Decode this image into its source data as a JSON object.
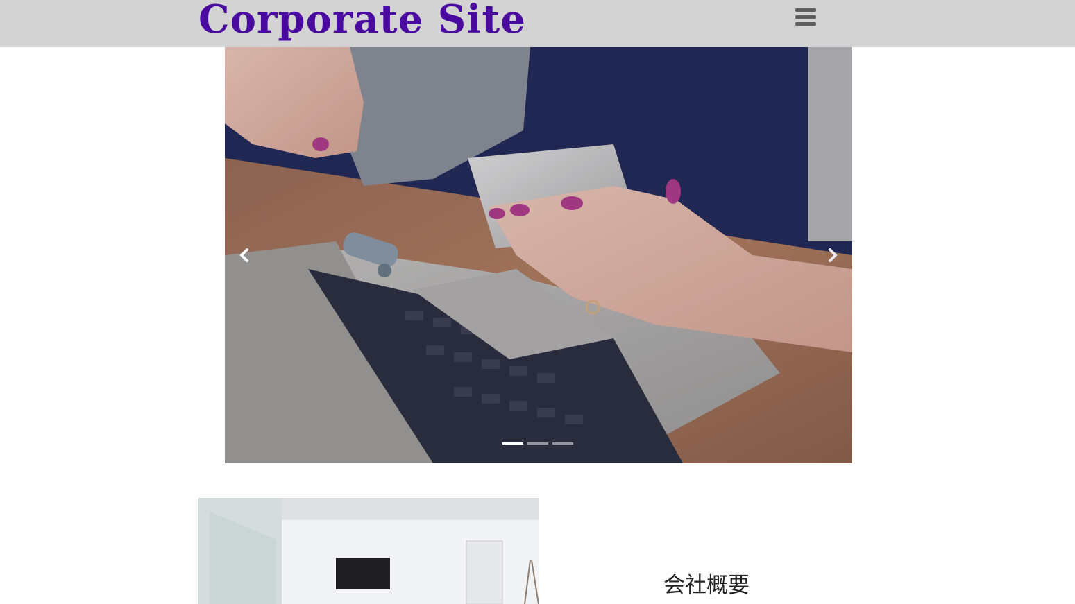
{
  "header": {
    "logo_text": "Corporate Site",
    "menu_icon": "hamburger-menu-icon"
  },
  "carousel": {
    "slide_count": 3,
    "active_index": 0,
    "prev_icon": "chevron-left-icon",
    "next_icon": "chevron-right-icon",
    "slide_description": "hands holding smartphone over laptop on wooden table"
  },
  "about": {
    "title": "会社概要",
    "photo_description": "white office interior with wall-mounted TV"
  },
  "colors": {
    "header_bg": "#d3d3d3",
    "logo": "#4b0a9f",
    "menu_icon": "#5e5e5e"
  }
}
